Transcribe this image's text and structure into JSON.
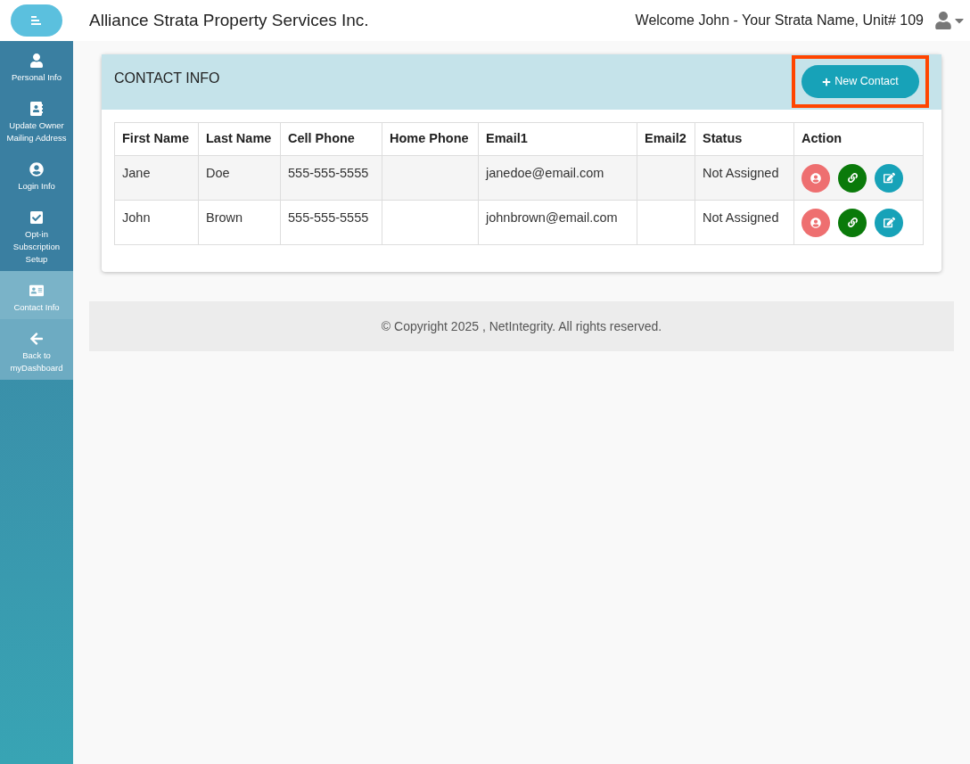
{
  "header": {
    "company": "Alliance Strata Property Services Inc.",
    "welcome": "Welcome John - Your Strata Name, Unit# 109"
  },
  "sidebar": {
    "items": [
      {
        "label": "Personal Info",
        "kind": "nav",
        "selected": false
      },
      {
        "label": "Update Owner Mailing Address",
        "kind": "nav",
        "selected": false
      },
      {
        "label": "Login Info",
        "kind": "nav",
        "selected": false
      },
      {
        "label": "Opt-in Subscription Setup",
        "kind": "nav",
        "selected": false
      },
      {
        "label": "Contact Info",
        "kind": "nav",
        "selected": true
      },
      {
        "label": "Back to myDashboard",
        "kind": "back",
        "selected": false
      }
    ]
  },
  "panel": {
    "title": "CONTACT INFO",
    "new_button": {
      "label": "New Contact",
      "highlighted": true
    }
  },
  "table": {
    "columns": [
      "First Name",
      "Last Name",
      "Cell Phone",
      "Home Phone",
      "Email1",
      "Email2",
      "Status",
      "Action"
    ],
    "rows": [
      {
        "cells": [
          "Jane",
          "Doe",
          "555-555-5555",
          "",
          "janedoe@email.com",
          "",
          "Not Assigned"
        ]
      },
      {
        "cells": [
          "John",
          "Brown",
          "555-555-5555",
          "",
          "johnbrown@email.com",
          "",
          "Not Assigned"
        ]
      }
    ]
  },
  "footer": {
    "text": "© Copyright 2025 , NetIntegrity. All rights reserved."
  }
}
